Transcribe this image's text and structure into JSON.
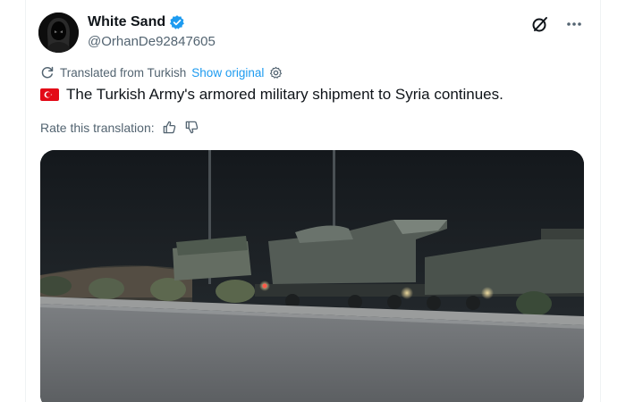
{
  "user": {
    "display_name": "White Sand",
    "handle": "@OrhanDe92847605",
    "verified": true
  },
  "icons": {
    "avatar": "hooded-figure-avatar",
    "verified": "verified-badge-icon",
    "grok": "grok-icon",
    "more": "more-icon",
    "translate": "translate-icon",
    "settings": "gear-icon",
    "flag": "turkey-flag-icon",
    "thumbs_up": "thumbs-up-icon",
    "thumbs_down": "thumbs-down-icon"
  },
  "translation": {
    "notice": "Translated from Turkish",
    "show_original": "Show original"
  },
  "tweet": {
    "text": "The Turkish Army's armored military shipment to Syria continues."
  },
  "rate": {
    "label": "Rate this translation:"
  },
  "colors": {
    "accent": "#1d9bf0",
    "secondary_text": "#536471",
    "flag_red": "#e30a17"
  }
}
